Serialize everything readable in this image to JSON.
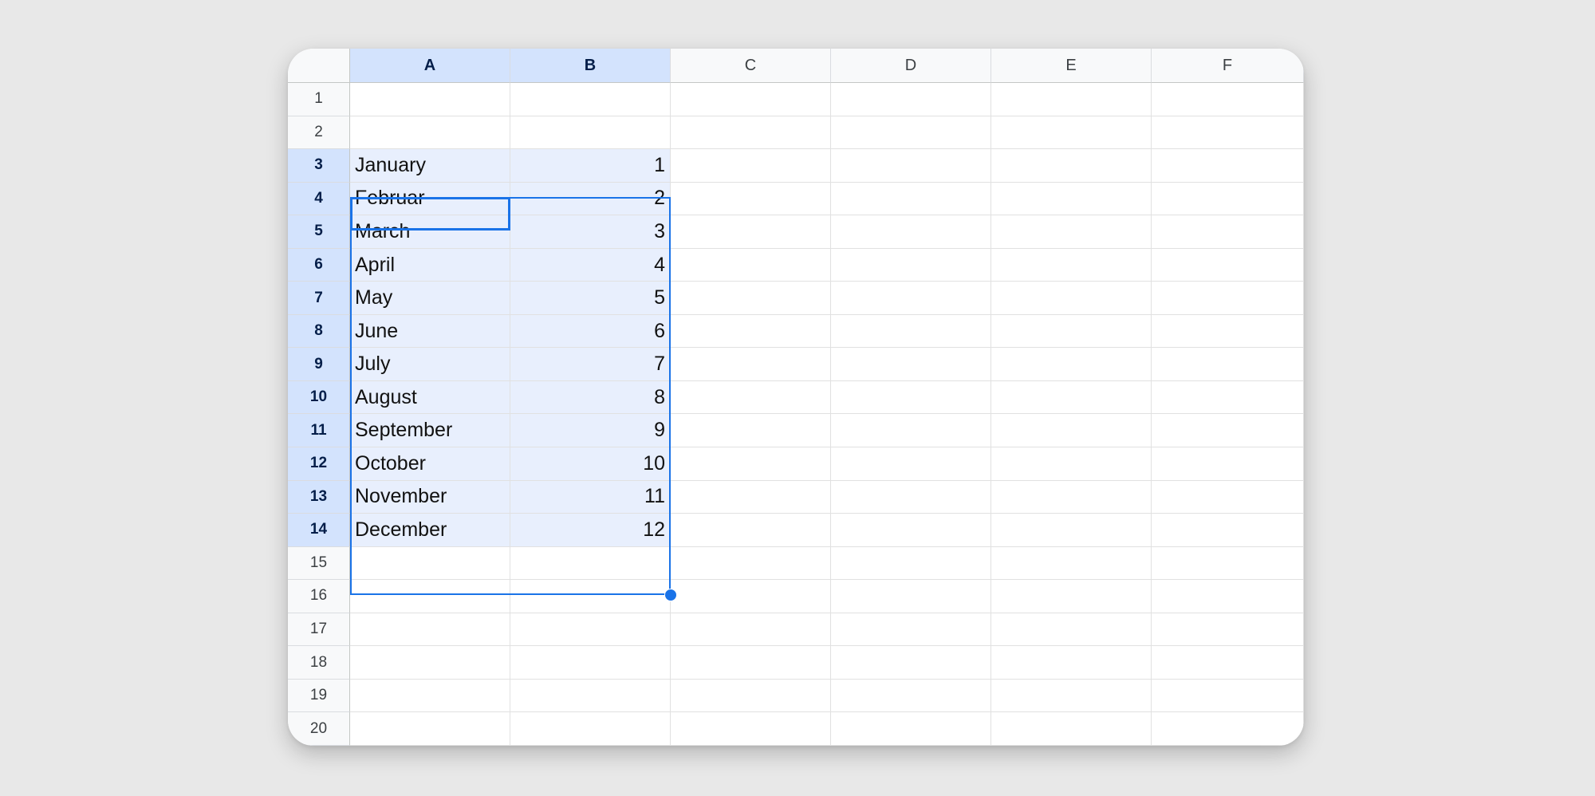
{
  "columns": [
    "A",
    "B",
    "C",
    "D",
    "E",
    "F"
  ],
  "selected_columns": [
    "A",
    "B"
  ],
  "row_count": 20,
  "selected_rows": [
    3,
    14
  ],
  "active_cell": "A3",
  "cells": {
    "A3": "January",
    "B3": "1",
    "A4": "Februar",
    "B4": "2",
    "A5": "March",
    "B5": "3",
    "A6": "April",
    "B6": "4",
    "A7": "May",
    "B7": "5",
    "A8": "June",
    "B8": "6",
    "A9": "July",
    "B9": "7",
    "A10": "August",
    "B10": "8",
    "A11": "September",
    "B11": "9",
    "A12": "October",
    "B12": "10",
    "A13": "November",
    "B13": "11",
    "A14": "December",
    "B14": "12"
  },
  "colors": {
    "selection_border": "#1a73e8",
    "selection_fill": "#e8effd",
    "header_selected": "#d3e3fd",
    "background": "#e8e8e8"
  }
}
